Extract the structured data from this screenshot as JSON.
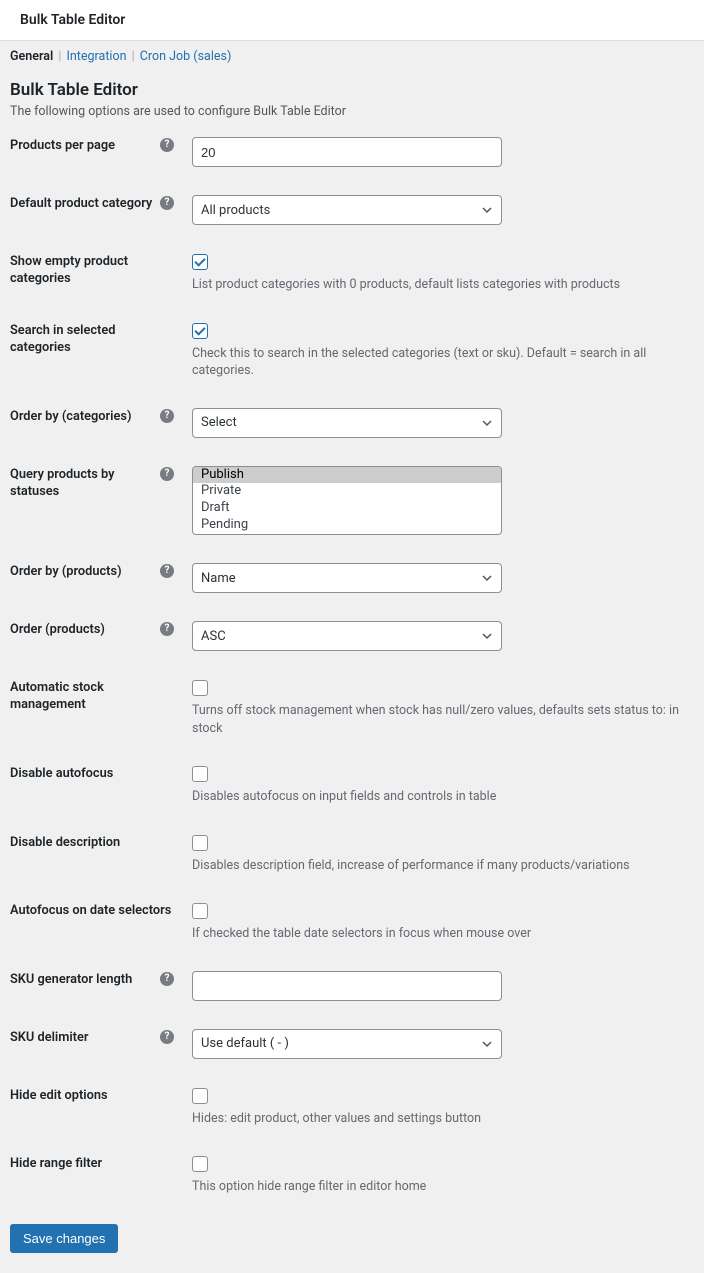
{
  "header": {
    "title": "Bulk Table Editor"
  },
  "tabs": {
    "general": "General",
    "integration": "Integration",
    "cron": "Cron Job (sales)"
  },
  "section": {
    "title": "Bulk Table Editor",
    "desc": "The following options are used to configure Bulk Table Editor"
  },
  "fields": {
    "products_per_page": {
      "label": "Products per page",
      "value": "20"
    },
    "default_category": {
      "label": "Default product category",
      "value": "All products"
    },
    "show_empty": {
      "label": "Show empty product categories",
      "help": "List product categories with 0 products, default lists categories with products"
    },
    "search_selected": {
      "label": "Search in selected categories",
      "help": "Check this to search in the selected categories (text or sku). Default = search in all categories."
    },
    "order_by_categories": {
      "label": "Order by (categories)",
      "value": "Select"
    },
    "query_statuses": {
      "label": "Query products by statuses",
      "options": {
        "publish": "Publish",
        "private": "Private",
        "draft": "Draft",
        "pending": "Pending"
      }
    },
    "order_by_products": {
      "label": "Order by (products)",
      "value": "Name"
    },
    "order_products": {
      "label": "Order (products)",
      "value": "ASC"
    },
    "auto_stock": {
      "label": "Automatic stock management",
      "help": "Turns off stock management when stock has null/zero values, defaults sets status to: in stock"
    },
    "disable_autofocus": {
      "label": "Disable autofocus",
      "help": "Disables autofocus on input fields and controls in table"
    },
    "disable_description": {
      "label": "Disable description",
      "help": "Disables description field, increase of performance if many products/variations"
    },
    "autofocus_date": {
      "label": "Autofocus on date selectors",
      "help": "If checked the table date selectors in focus when mouse over"
    },
    "sku_length": {
      "label": "SKU generator length",
      "value": ""
    },
    "sku_delimiter": {
      "label": "SKU delimiter",
      "value": "Use default ( - )"
    },
    "hide_edit": {
      "label": "Hide edit options",
      "help": "Hides: edit product, other values and settings button"
    },
    "hide_range": {
      "label": "Hide range filter",
      "help": "This option hide range filter in editor home"
    }
  },
  "buttons": {
    "save": "Save changes"
  }
}
